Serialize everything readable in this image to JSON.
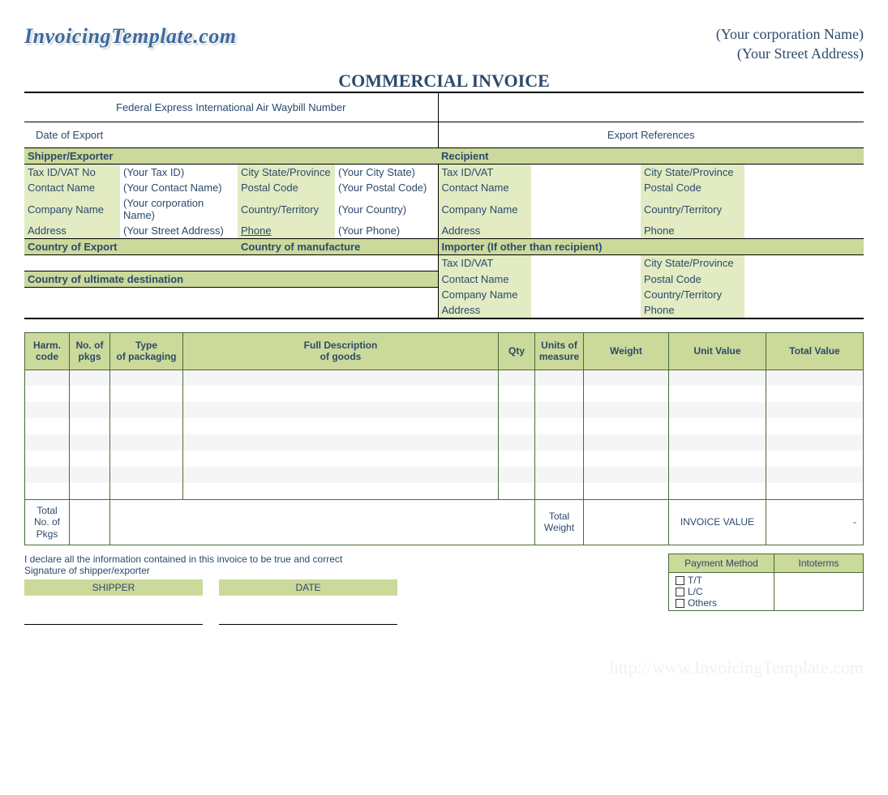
{
  "logo_text": "InvoicingTemplate.com",
  "corp": {
    "name": "(Your corporation  Name)",
    "address": "(Your Street Address)"
  },
  "title": "COMMERCIAL INVOICE",
  "waybill_label": "Federal Express International Air Waybill Number",
  "date_export_label": "Date of Export",
  "export_ref_label": "Export References",
  "shipper": {
    "header": "Shipper/Exporter",
    "tax_label": "Tax ID/VAT No",
    "tax_val": "(Your Tax ID)",
    "contact_label": "Contact Name",
    "contact_val": "(Your Contact Name)",
    "company_label": "Company Name",
    "company_val": "(Your corporation  Name)",
    "address_label": "Address",
    "address_val": "(Your Street Address)",
    "city_label": "City  State/Province",
    "city_val": "(Your City State)",
    "postal_label": "Postal Code",
    "postal_val": "(Your Postal Code)",
    "country_label": "Country/Territory",
    "country_val": "(Your Country)",
    "phone_label": "Phone",
    "phone_val": "(Your Phone)"
  },
  "recipient": {
    "header": "Recipient",
    "tax_label": "Tax ID/VAT",
    "contact_label": "Contact Name",
    "company_label": "Company Name",
    "address_label": "Address",
    "city_label": "City  State/Province",
    "postal_label": "Postal Code",
    "country_label": "Country/Territory",
    "phone_label": "Phone"
  },
  "export": {
    "country_export_label": "Country of Export",
    "country_manuf_label": "Country of manufacture",
    "country_dest_label": "Country of ultimate destination"
  },
  "importer": {
    "header": "Importer (If other than recipient)",
    "tax_label": "Tax ID/VAT",
    "contact_label": "Contact Name",
    "company_label": "Company Name",
    "address_label": "Address",
    "city_label": "City  State/Province",
    "postal_label": "Postal Code",
    "country_label": "Country/Territory",
    "phone_label": "Phone"
  },
  "cols": {
    "harm": "Harm.\ncode",
    "pkgs": "No. of\npkgs",
    "pack_type": "Type\nof packaging",
    "desc": "Full Description\nof goods",
    "qty": "Qty",
    "unit_meas": "Units of\nmeasure",
    "weight": "Weight",
    "unit_val": "Unit Value",
    "total_val": "Total Value"
  },
  "totals": {
    "pkgs_label": "Total\nNo. of\nPkgs",
    "weight_label": "Total\nWeight",
    "invoice_value_label": "INVOICE VALUE",
    "invoice_value": "-"
  },
  "declare_line": "I declare all the information contained in this invoice to be true and correct",
  "sig_label": "Signature of shipper/exporter",
  "sig_shipper": "SHIPPER",
  "sig_date": "DATE",
  "payment": {
    "header": "Payment Method",
    "incoterms": "Intoterms",
    "tt": "T/T",
    "lc": "L/C",
    "others": "Others"
  },
  "watermark": "http://www.InvoicingTemplate.com"
}
